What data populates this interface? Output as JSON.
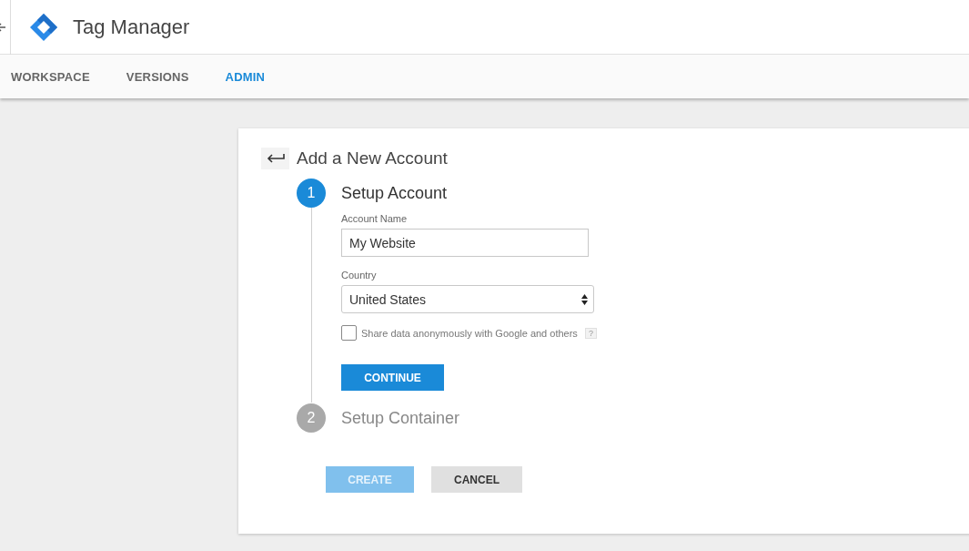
{
  "header": {
    "app_name": "Tag Manager"
  },
  "tabs": [
    {
      "label": "WORKSPACE",
      "selected": false
    },
    {
      "label": "VERSIONS",
      "selected": false
    },
    {
      "label": "ADMIN",
      "selected": true
    }
  ],
  "card": {
    "title": "Add a New Account",
    "steps": [
      {
        "number": "1",
        "title": "Setup Account",
        "active": true,
        "fields": [
          {
            "kind": "text",
            "label": "Account Name",
            "value": "My Website"
          },
          {
            "kind": "select",
            "label": "Country",
            "value": "United States"
          }
        ],
        "checkbox": {
          "label": "Share data anonymously with Google and others",
          "checked": false,
          "help": "?"
        },
        "button": "CONTINUE"
      },
      {
        "number": "2",
        "title": "Setup Container",
        "active": false
      }
    ],
    "actions": [
      {
        "label": "CREATE",
        "kind": "primary",
        "disabled": true
      },
      {
        "label": "CANCEL",
        "kind": "secondary",
        "disabled": false
      }
    ]
  }
}
